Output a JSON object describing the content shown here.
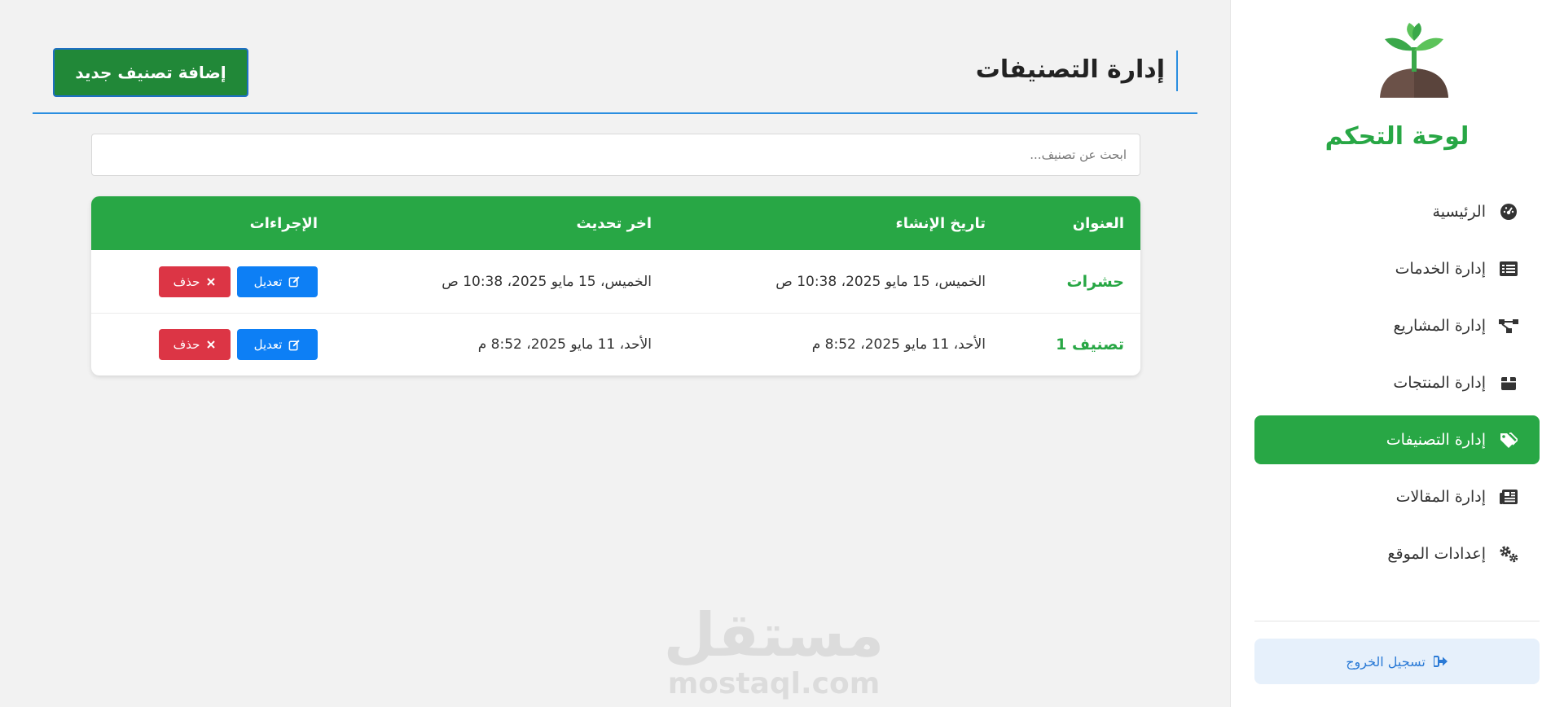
{
  "sidebar": {
    "brand": "لوحة التحكم",
    "items": [
      {
        "label": "الرئيسية",
        "icon": "dashboard-icon"
      },
      {
        "label": "إدارة الخدمات",
        "icon": "list-icon"
      },
      {
        "label": "إدارة المشاريع",
        "icon": "project-diagram-icon"
      },
      {
        "label": "إدارة المنتجات",
        "icon": "box-icon"
      },
      {
        "label": "إدارة التصنيفات",
        "icon": "tags-icon",
        "active": true
      },
      {
        "label": "إدارة المقالات",
        "icon": "newspaper-icon"
      },
      {
        "label": "إعدادات الموقع",
        "icon": "cogs-icon"
      }
    ],
    "logout": "تسجيل الخروج"
  },
  "header": {
    "title": "إدارة التصنيفات",
    "add_button": "إضافة تصنيف جديد"
  },
  "search": {
    "placeholder": "ابحث عن تصنيف..."
  },
  "table": {
    "columns": [
      "العنوان",
      "تاريخ الإنشاء",
      "اخر تحديث",
      "الإجراءات"
    ],
    "rows": [
      {
        "title": "حشرات",
        "created": "الخميس، 15 مايو 2025، 10:38 ص",
        "updated": "الخميس، 15 مايو 2025، 10:38 ص"
      },
      {
        "title": "تصنيف 1",
        "created": "الأحد، 11 مايو 2025، 8:52 م",
        "updated": "الأحد، 11 مايو 2025، 8:52 م"
      }
    ],
    "edit_label": "تعديل",
    "delete_label": "حذف"
  },
  "watermark": {
    "arabic": "مستقل",
    "latin": "mostaql.com"
  },
  "colors": {
    "brand_green": "#28a745",
    "accent_blue": "#2a8ee0",
    "edit_blue": "#0d7ff5",
    "delete_red": "#dc3545"
  }
}
